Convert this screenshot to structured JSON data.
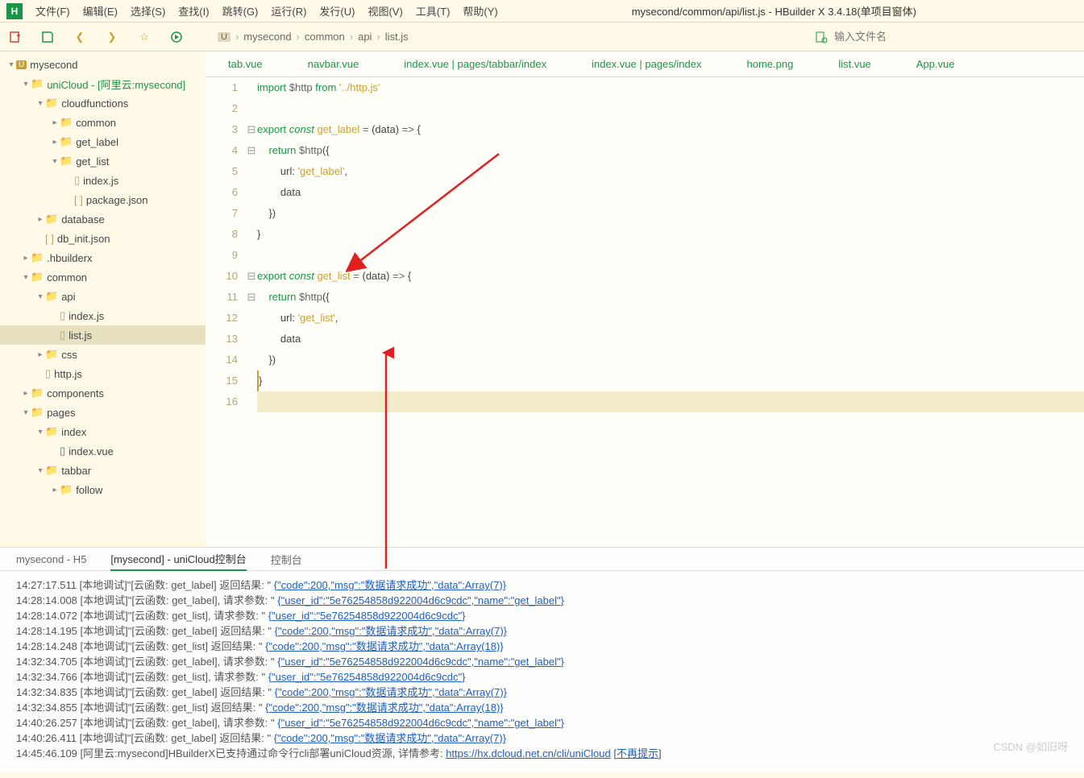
{
  "menu": {
    "items": [
      "文件(F)",
      "编辑(E)",
      "选择(S)",
      "查找(I)",
      "跳转(G)",
      "运行(R)",
      "发行(U)",
      "视图(V)",
      "工具(T)",
      "帮助(Y)"
    ],
    "title": "mysecond/common/api/list.js - HBuilder X 3.4.18(单项目窗体)"
  },
  "breadcrumb": [
    "mysecond",
    "common",
    "api",
    "list.js"
  ],
  "search_placeholder": "输入文件名",
  "tabs": [
    "tab.vue",
    "navbar.vue",
    "index.vue | pages/tabbar/index",
    "index.vue | pages/index",
    "home.png",
    "list.vue",
    "App.vue"
  ],
  "tree": [
    {
      "d": 0,
      "t": "mysecond",
      "chev": "▾",
      "ico": "u"
    },
    {
      "d": 1,
      "t": "uniCloud - [阿里云:mysecond]",
      "chev": "▾",
      "ico": "fold",
      "cls": "green"
    },
    {
      "d": 2,
      "t": "cloudfunctions",
      "chev": "▾",
      "ico": "fold"
    },
    {
      "d": 3,
      "t": "common",
      "chev": "▸",
      "ico": "fold"
    },
    {
      "d": 3,
      "t": "get_label",
      "chev": "▸",
      "ico": "fold"
    },
    {
      "d": 3,
      "t": "get_list",
      "chev": "▾",
      "ico": "fold"
    },
    {
      "d": 4,
      "t": "index.js",
      "ico": "js"
    },
    {
      "d": 4,
      "t": "package.json",
      "ico": "json"
    },
    {
      "d": 2,
      "t": "database",
      "chev": "▸",
      "ico": "fold"
    },
    {
      "d": 2,
      "t": "db_init.json",
      "ico": "json"
    },
    {
      "d": 1,
      "t": ".hbuilderx",
      "chev": "▸",
      "ico": "fold"
    },
    {
      "d": 1,
      "t": "common",
      "chev": "▾",
      "ico": "fold"
    },
    {
      "d": 2,
      "t": "api",
      "chev": "▾",
      "ico": "fold"
    },
    {
      "d": 3,
      "t": "index.js",
      "ico": "js"
    },
    {
      "d": 3,
      "t": "list.js",
      "ico": "js",
      "active": true
    },
    {
      "d": 2,
      "t": "css",
      "chev": "▸",
      "ico": "fold"
    },
    {
      "d": 2,
      "t": "http.js",
      "ico": "js"
    },
    {
      "d": 1,
      "t": "components",
      "chev": "▸",
      "ico": "fold"
    },
    {
      "d": 1,
      "t": "pages",
      "chev": "▾",
      "ico": "fold"
    },
    {
      "d": 2,
      "t": "index",
      "chev": "▾",
      "ico": "fold"
    },
    {
      "d": 3,
      "t": "index.vue",
      "ico": "vue"
    },
    {
      "d": 2,
      "t": "tabbar",
      "chev": "▾",
      "ico": "fold"
    },
    {
      "d": 3,
      "t": "follow",
      "chev": "▸",
      "ico": "fold"
    }
  ],
  "code": [
    {
      "n": 1,
      "html": "<span class='kw'>import</span> <span class='var'>$http</span> <span class='kw'>from</span> <span class='str'>'../http.js'</span>"
    },
    {
      "n": 2,
      "html": ""
    },
    {
      "n": 3,
      "fold": "⊟",
      "html": "<span class='kw'>export</span> <span class='kw2'>const</span> <span class='fn'>get_label</span> <span class='op'>=</span> (data) <span class='op'>=&gt;</span> {"
    },
    {
      "n": 4,
      "fold": "⊟",
      "html": "    <span class='kw'>return</span> <span class='var'>$http</span>({"
    },
    {
      "n": 5,
      "html": "        url: <span class='str'>'get_label'</span>,"
    },
    {
      "n": 6,
      "html": "        data"
    },
    {
      "n": 7,
      "html": "    })"
    },
    {
      "n": 8,
      "html": "}"
    },
    {
      "n": 9,
      "html": ""
    },
    {
      "n": 10,
      "fold": "⊟",
      "html": "<span class='kw'>export</span> <span class='kw2'>const</span> <span class='fn'>get_list</span> <span class='op'>=</span> (data) <span class='op'>=&gt;</span> {"
    },
    {
      "n": 11,
      "fold": "⊟",
      "html": "    <span class='kw'>return</span> <span class='var'>$http</span>({"
    },
    {
      "n": 12,
      "html": "        url: <span class='str'>'get_list'</span>,"
    },
    {
      "n": 13,
      "html": "        data"
    },
    {
      "n": 14,
      "html": "    })"
    },
    {
      "n": 15,
      "html": "}",
      "cursor": true
    },
    {
      "n": 16,
      "html": "",
      "hl": true
    }
  ],
  "bottom_tabs": [
    {
      "t": "mysecond - H5"
    },
    {
      "t": "[mysecond] - uniCloud控制台",
      "active": true
    },
    {
      "t": "控制台"
    }
  ],
  "console": [
    {
      "ts": "14:27:17.511",
      "pre": "[本地调试]\"[云函数: get_label] 返回结果: \" ",
      "link": "{\"code\":200,\"msg\":\"数据请求成功\",\"data\":Array(7)}"
    },
    {
      "ts": "14:28:14.008",
      "pre": "[本地调试]\"[云函数: get_label], 请求参数: \" ",
      "link": "{\"user_id\":\"5e76254858d922004d6c9cdc\",\"name\":\"get_label\"}"
    },
    {
      "ts": "14:28:14.072",
      "pre": "[本地调试]\"[云函数: get_list], 请求参数: \" ",
      "link": "{\"user_id\":\"5e76254858d922004d6c9cdc\"}"
    },
    {
      "ts": "14:28:14.195",
      "pre": "[本地调试]\"[云函数: get_label] 返回结果: \" ",
      "link": "{\"code\":200,\"msg\":\"数据请求成功\",\"data\":Array(7)}"
    },
    {
      "ts": "14:28:14.248",
      "pre": "[本地调试]\"[云函数: get_list] 返回结果: \" ",
      "link": "{\"code\":200,\"msg\":\"数据请求成功\",\"data\":Array(18)}"
    },
    {
      "ts": "14:32:34.705",
      "pre": "[本地调试]\"[云函数: get_label], 请求参数: \" ",
      "link": "{\"user_id\":\"5e76254858d922004d6c9cdc\",\"name\":\"get_label\"}"
    },
    {
      "ts": "14:32:34.766",
      "pre": "[本地调试]\"[云函数: get_list], 请求参数: \" ",
      "link": "{\"user_id\":\"5e76254858d922004d6c9cdc\"}"
    },
    {
      "ts": "14:32:34.835",
      "pre": "[本地调试]\"[云函数: get_label] 返回结果: \" ",
      "link": "{\"code\":200,\"msg\":\"数据请求成功\",\"data\":Array(7)}"
    },
    {
      "ts": "14:32:34.855",
      "pre": "[本地调试]\"[云函数: get_list] 返回结果: \" ",
      "link": "{\"code\":200,\"msg\":\"数据请求成功\",\"data\":Array(18)}"
    },
    {
      "ts": "14:40:26.257",
      "pre": "[本地调试]\"[云函数: get_label], 请求参数: \" ",
      "link": "{\"user_id\":\"5e76254858d922004d6c9cdc\",\"name\":\"get_label\"}"
    },
    {
      "ts": "14:40:26.411",
      "pre": "[本地调试]\"[云函数: get_label] 返回结果: \" ",
      "link": "{\"code\":200,\"msg\":\"数据请求成功\",\"data\":Array(7)}"
    },
    {
      "ts": "14:45:46.109",
      "pre": "[阿里云:mysecond]HBuilderX已支持通过命令行cli部署uniCloud资源, 详情参考: ",
      "link": "https://hx.dcloud.net.cn/cli/uniCloud",
      "suf": "  [",
      "link2": "不再提示",
      "suf2": "]"
    }
  ],
  "watermark": "CSDN @如旧呀"
}
